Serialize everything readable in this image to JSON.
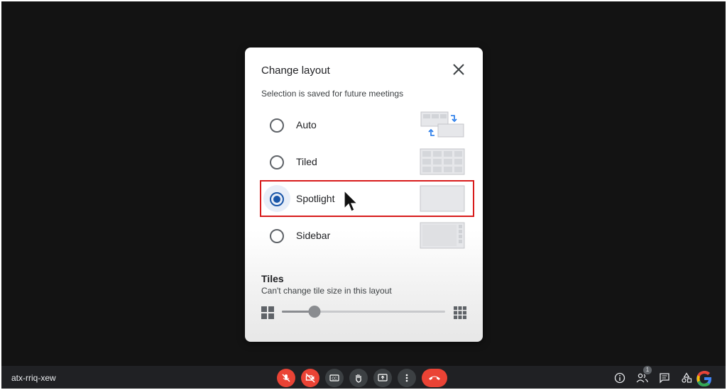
{
  "dialog": {
    "title": "Change layout",
    "subtitle": "Selection is saved for future meetings",
    "options": [
      {
        "label": "Auto",
        "selected": false
      },
      {
        "label": "Tiled",
        "selected": false
      },
      {
        "label": "Spotlight",
        "selected": true
      },
      {
        "label": "Sidebar",
        "selected": false
      }
    ],
    "tiles": {
      "title": "Tiles",
      "subtitle": "Can't change tile size in this layout",
      "slider_fraction": 0.2
    }
  },
  "bottom_bar": {
    "meeting_code": "atx-rriq-xew",
    "participant_count": "1"
  },
  "colors": {
    "accent": "#1a56a8",
    "highlight_box": "#d81b1b",
    "meet_red": "#ea4335",
    "meet_dark": "#202124"
  },
  "icons": [
    "close-icon",
    "auto-layout-thumb",
    "tiled-layout-thumb",
    "spotlight-layout-thumb",
    "sidebar-layout-thumb",
    "small-tiles-icon",
    "large-tiles-icon",
    "mic-off-icon",
    "camera-off-icon",
    "captions-icon",
    "raise-hand-icon",
    "present-icon",
    "more-options-icon",
    "hang-up-icon",
    "info-icon",
    "people-icon",
    "chat-icon",
    "activities-icon",
    "google-logo"
  ]
}
